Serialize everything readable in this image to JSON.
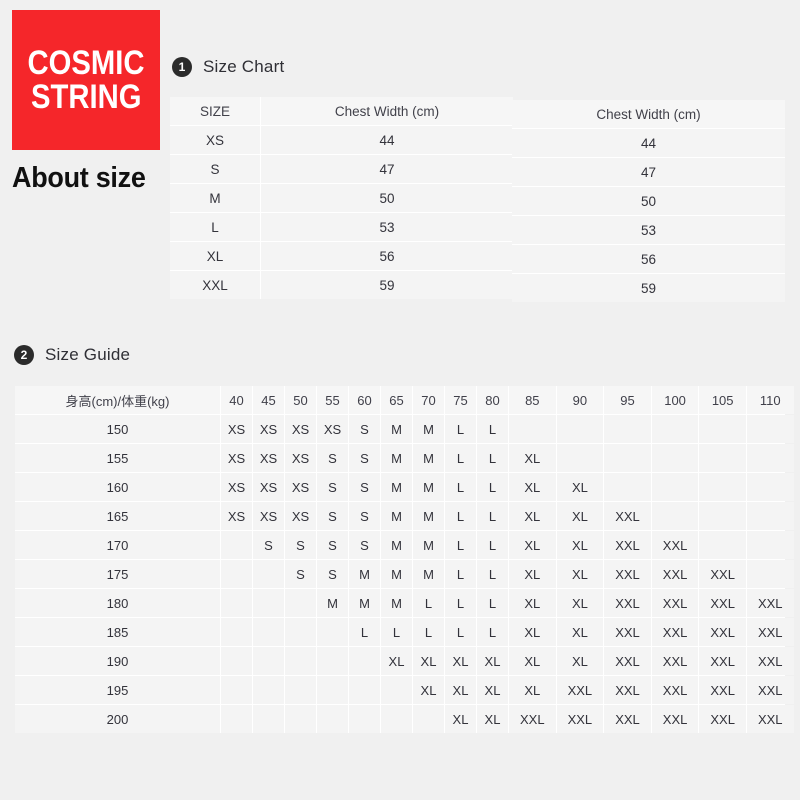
{
  "brand": {
    "logo_line1": "COSMIC",
    "logo_line2": "STRING",
    "logo_bg_color": "#f5262a",
    "about_title": "About size"
  },
  "sections": {
    "size_chart": {
      "badge": "1",
      "title": "Size Chart",
      "headers": [
        "SIZE",
        "Chest Width (cm)",
        "Chest Width (cm)"
      ],
      "rows": [
        {
          "size": "XS",
          "chest_1": "44",
          "chest_2": "44"
        },
        {
          "size": "S",
          "chest_1": "47",
          "chest_2": "47"
        },
        {
          "size": "M",
          "chest_1": "50",
          "chest_2": "50"
        },
        {
          "size": "L",
          "chest_1": "53",
          "chest_2": "53"
        },
        {
          "size": "XL",
          "chest_1": "56",
          "chest_2": "56"
        },
        {
          "size": "XXL",
          "chest_1": "59",
          "chest_2": "59"
        }
      ]
    },
    "size_guide": {
      "badge": "2",
      "title": "Size Guide",
      "corner_header": "身高(cm)/体重(kg)",
      "weight_headers": [
        "40",
        "45",
        "50",
        "55",
        "60",
        "65",
        "70",
        "75",
        "80",
        "85",
        "90",
        "95",
        "100",
        "105",
        "110"
      ],
      "rows": [
        {
          "height": "150",
          "values": [
            "XS",
            "XS",
            "XS",
            "XS",
            "S",
            "M",
            "M",
            "L",
            "L",
            "",
            "",
            "",
            "",
            "",
            ""
          ]
        },
        {
          "height": "155",
          "values": [
            "XS",
            "XS",
            "XS",
            "S",
            "S",
            "M",
            "M",
            "L",
            "L",
            "XL",
            "",
            "",
            "",
            "",
            ""
          ]
        },
        {
          "height": "160",
          "values": [
            "XS",
            "XS",
            "XS",
            "S",
            "S",
            "M",
            "M",
            "L",
            "L",
            "XL",
            "XL",
            "",
            "",
            "",
            ""
          ]
        },
        {
          "height": "165",
          "values": [
            "XS",
            "XS",
            "XS",
            "S",
            "S",
            "M",
            "M",
            "L",
            "L",
            "XL",
            "XL",
            "XXL",
            "",
            "",
            ""
          ]
        },
        {
          "height": "170",
          "values": [
            "",
            "S",
            "S",
            "S",
            "S",
            "M",
            "M",
            "L",
            "L",
            "XL",
            "XL",
            "XXL",
            "XXL",
            "",
            ""
          ]
        },
        {
          "height": "175",
          "values": [
            "",
            "",
            "S",
            "S",
            "M",
            "M",
            "M",
            "L",
            "L",
            "XL",
            "XL",
            "XXL",
            "XXL",
            "XXL",
            ""
          ]
        },
        {
          "height": "180",
          "values": [
            "",
            "",
            "",
            "M",
            "M",
            "M",
            "L",
            "L",
            "L",
            "XL",
            "XL",
            "XXL",
            "XXL",
            "XXL",
            "XXL"
          ]
        },
        {
          "height": "185",
          "values": [
            "",
            "",
            "",
            "",
            "L",
            "L",
            "L",
            "L",
            "L",
            "XL",
            "XL",
            "XXL",
            "XXL",
            "XXL",
            "XXL"
          ]
        },
        {
          "height": "190",
          "values": [
            "",
            "",
            "",
            "",
            "",
            "XL",
            "XL",
            "XL",
            "XL",
            "XL",
            "XL",
            "XXL",
            "XXL",
            "XXL",
            "XXL"
          ]
        },
        {
          "height": "195",
          "values": [
            "",
            "",
            "",
            "",
            "",
            "",
            "XL",
            "XL",
            "XL",
            "XL",
            "XXL",
            "XXL",
            "XXL",
            "XXL",
            "XXL"
          ]
        },
        {
          "height": "200",
          "values": [
            "",
            "",
            "",
            "",
            "",
            "",
            "",
            "XL",
            "XL",
            "XXL",
            "XXL",
            "XXL",
            "XXL",
            "XXL",
            "XXL"
          ]
        }
      ]
    }
  }
}
